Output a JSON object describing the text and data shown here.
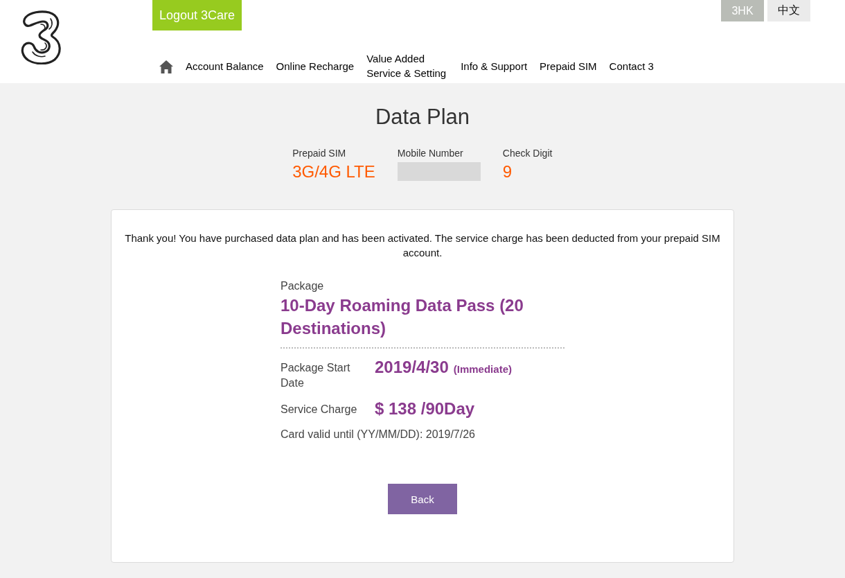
{
  "header": {
    "logout_button": "Logout 3Care",
    "languages": [
      {
        "label": "3HK",
        "selected": true
      },
      {
        "label": "中文",
        "selected": false
      }
    ],
    "nav": [
      "Account Balance",
      "Online Recharge",
      "Value Added Service & Setting",
      "Info & Support",
      "Prepaid SIM",
      "Contact 3"
    ]
  },
  "page_title": "Data Plan",
  "account_info": [
    {
      "kind": "text",
      "label": "Prepaid SIM",
      "value": "3G/4G LTE"
    },
    {
      "kind": "redacted",
      "label": "Mobile Number"
    },
    {
      "kind": "text",
      "label": "Check Digit",
      "value": "9"
    }
  ],
  "confirmation": {
    "message": "Thank you! You have purchased data plan and has been activated. The service charge has been deducted from your prepaid SIM account.",
    "package_label": "Package",
    "package_name": "10-Day Roaming Data Pass (20 Destinations)",
    "details": [
      {
        "label": "Package Start Date",
        "value": "2019/4/30",
        "note": "(Immediate)"
      },
      {
        "label": "Service Charge",
        "value": "$ 138 /90Day"
      }
    ],
    "validity": "Card valid until (YY/MM/DD): 2019/7/26",
    "back_button": "Back"
  }
}
